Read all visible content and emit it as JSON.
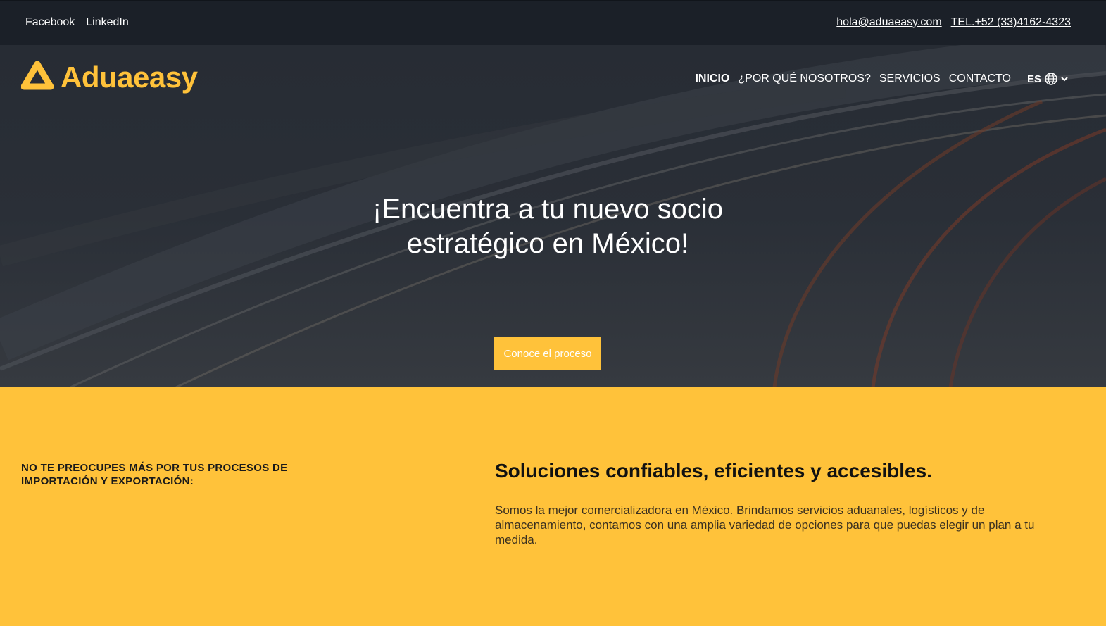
{
  "topbar": {
    "social": [
      "Facebook",
      "LinkedIn"
    ],
    "email": "hola@aduaeasy.com",
    "phone": "TEL.+52 (33)4162-4323"
  },
  "brand": {
    "name": "Aduaeasy",
    "color": "#ffc23a"
  },
  "nav": {
    "items": [
      "INICIO",
      "¿POR QUÉ NOSOTROS?",
      "SERVICIOS",
      "CONTACTO"
    ],
    "active": "INICIO",
    "language": "ES"
  },
  "hero": {
    "title_line1": "¡Encuentra a tu nuevo socio",
    "title_line2": "estratégico en México!",
    "cta_label": "Conoce el proceso"
  },
  "features": {
    "kicker": "NO TE PREOCUPES MÁS POR TUS PROCESOS DE IMPORTACIÓN Y EXPORTACIÓN:",
    "title": "Soluciones confiables, eficientes y accesibles.",
    "text": "Somos la mejor comercializadora en México. Brindamos servicios aduanales, logísticos y de almacenamiento, contamos con una amplia variedad de opciones para que puedas elegir un plan a tu medida."
  },
  "colors": {
    "topbar": "#1b2028",
    "accent": "#ffc23a",
    "hero_bg": "#2a2f37"
  }
}
